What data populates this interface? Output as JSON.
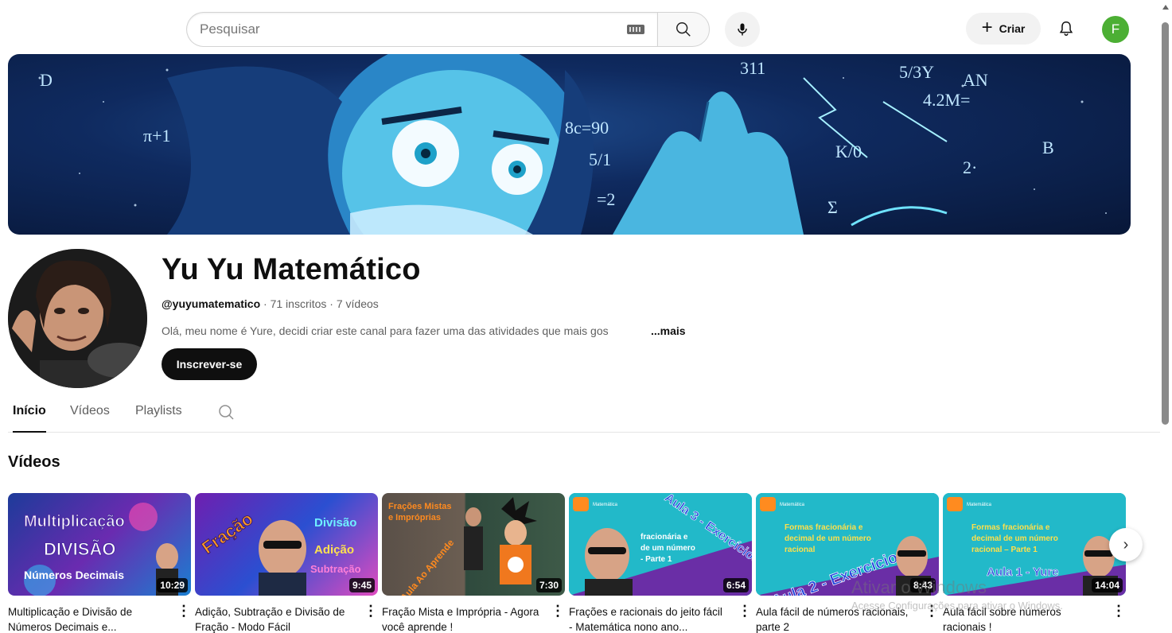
{
  "search": {
    "placeholder": "Pesquisar"
  },
  "header": {
    "create_label": "Criar",
    "avatar_letter": "F"
  },
  "channel": {
    "name": "Yu Yu Matemático",
    "handle": "@yuyumatematico",
    "subscribers": "71 inscritos",
    "videos_count": "7 vídeos",
    "description": "Olá, meu nome é Yure, decidi criar este canal para fazer uma das atividades que mais gos",
    "more_label": "...mais",
    "subscribe_label": "Inscrever-se"
  },
  "tabs": [
    {
      "label": "Início",
      "active": true
    },
    {
      "label": "Vídeos",
      "active": false
    },
    {
      "label": "Playlists",
      "active": false
    }
  ],
  "section_title": "Vídeos",
  "videos": [
    {
      "title": "Multiplicação e Divisão de Números Decimais e...",
      "duration": "10:29",
      "thumb_text": "Multiplicação DIVISÃO Números Decimais"
    },
    {
      "title": "Adição, Subtração e Divisão de Fração - Modo Fácil",
      "duration": "9:45",
      "thumb_text": "Fração Divisão Adição Subtração"
    },
    {
      "title": "Fração Mista e Imprópria - Agora você aprende !",
      "duration": "7:30",
      "thumb_text": "Frações Mistas e Impróprias"
    },
    {
      "title": "Frações e racionais do jeito fácil - Matemática nono ano...",
      "duration": "6:54",
      "thumb_text": "Aula 3 - Exercícios"
    },
    {
      "title": "Aula fácil de números racionais, parte 2",
      "duration": "8:43",
      "thumb_text": "Aula 2 - Exercícios"
    },
    {
      "title": "Aula fácil sobre números racionais !",
      "duration": "14:04",
      "thumb_text": "Aula 1 - Yure"
    }
  ],
  "watermark": {
    "line1": "Ativar o Windows",
    "line2": "Acesse Configurações para ativar o Windows."
  }
}
